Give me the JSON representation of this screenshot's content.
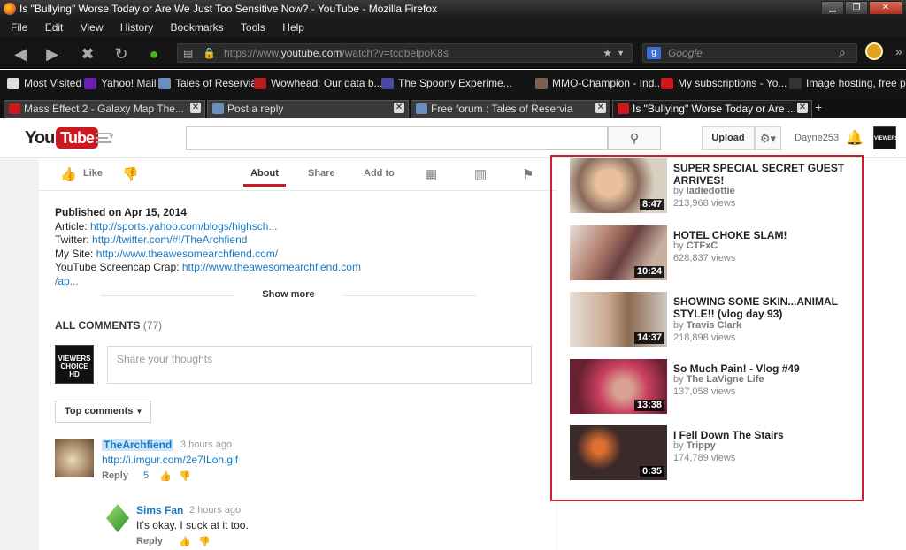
{
  "window": {
    "title": "Is \"Bullying\" Worse Today or Are We Just Too Sensitive Now? - YouTube - Mozilla Firefox"
  },
  "menu": [
    "File",
    "Edit",
    "View",
    "History",
    "Bookmarks",
    "Tools",
    "Help"
  ],
  "nav": {
    "url_prefix": "https://www.",
    "url_domain": "youtube.com",
    "url_path": "/watch?v=tcqbelpoK8s",
    "search_placeholder": "Google"
  },
  "bookmarks": [
    {
      "label": "Most Visited",
      "color": "#dddddd"
    },
    {
      "label": "Yahoo! Mail",
      "color": "#6b1fb1"
    },
    {
      "label": "Tales of Reservia",
      "color": "#6a8fbf"
    },
    {
      "label": "Wowhead: Our data b...",
      "color": "#b82020"
    },
    {
      "label": "The Spoony Experime...",
      "color": "#4a4aa0"
    },
    {
      "label": "MMO-Champion - Ind...",
      "color": "#7a6050"
    },
    {
      "label": "My subscriptions - Yo...",
      "color": "#cc181e"
    },
    {
      "label": "Image hosting, free p...",
      "color": "#333333"
    }
  ],
  "tabs": [
    {
      "label": "Mass Effect 2 - Galaxy Map The...",
      "color": "#cc181e"
    },
    {
      "label": "Post a reply",
      "color": "#6a8fbf"
    },
    {
      "label": "Free forum : Tales of Reservia",
      "color": "#6a8fbf"
    },
    {
      "label": "Is \"Bullying\" Worse Today or Are ...",
      "color": "#cc181e"
    }
  ],
  "yt_header": {
    "logo_you": "You",
    "logo_tube": "Tube",
    "upload": "Upload",
    "username": "Dayne253",
    "avatar_text": "VIEWERS CHOICE"
  },
  "actions": {
    "like": "Like",
    "tabs": [
      "About",
      "Share",
      "Add to"
    ]
  },
  "description": {
    "published": "Published on Apr 15, 2014",
    "lines": [
      {
        "label": "Article: ",
        "link": "http://sports.yahoo.com/blogs/highsch..."
      },
      {
        "label": "Twitter: ",
        "link": "http://twitter.com/#!/TheArchfiend"
      },
      {
        "label": "My Site: ",
        "link": "http://www.theawesomearchfiend.com/"
      },
      {
        "label": "YouTube Screencap Crap: ",
        "link": "http://www.theawesomearchfiend.com"
      }
    ],
    "overflow_link": "/ap...",
    "show_more": "Show more"
  },
  "comments": {
    "header": "ALL COMMENTS",
    "count": "(77)",
    "avatar_lines": [
      "VIEWERS",
      "CHOICE",
      "HD"
    ],
    "placeholder": "Share your thoughts",
    "sort": "Top comments",
    "items": [
      {
        "author": "TheArchfiend",
        "time": "3 hours ago",
        "text": "http://i.imgur.com/2e7ILoh.gif",
        "reply": "Reply",
        "likes": "5"
      },
      {
        "author": "Sims Fan",
        "time": "2 hours ago",
        "text": "It's okay. I suck at it too.",
        "reply": "Reply",
        "likes": ""
      }
    ]
  },
  "related": [
    {
      "title": "SUPER SPECIAL SECRET GUEST ARRIVES!",
      "by": "by",
      "channel": "ladiedottie",
      "views": "213,968 views",
      "duration": "8:47",
      "colors": [
        "#c8a88a",
        "#6a4a3a"
      ]
    },
    {
      "title": "HOTEL CHOKE SLAM!",
      "by": "by",
      "channel": "CTFxC",
      "views": "628,837 views",
      "duration": "10:24",
      "colors": [
        "#b08070",
        "#503a3a"
      ]
    },
    {
      "title": "SHOWING SOME SKIN...ANIMAL STYLE!! (vlog day 93)",
      "by": "by",
      "channel": "Travis Clark",
      "views": "218,898 views",
      "duration": "14:37",
      "colors": [
        "#d8c8b8",
        "#7a6a5a"
      ]
    },
    {
      "title": "So Much Pain! - Vlog #49",
      "by": "by",
      "channel": "The LaVigne Life",
      "views": "137,058 views",
      "duration": "13:38",
      "colors": [
        "#c84060",
        "#6a2030"
      ]
    },
    {
      "title": "I Fell Down The Stairs",
      "by": "by",
      "channel": "Trippy",
      "views": "174,789 views",
      "duration": "0:35",
      "colors": [
        "#3a2a2a",
        "#c06030"
      ]
    }
  ]
}
